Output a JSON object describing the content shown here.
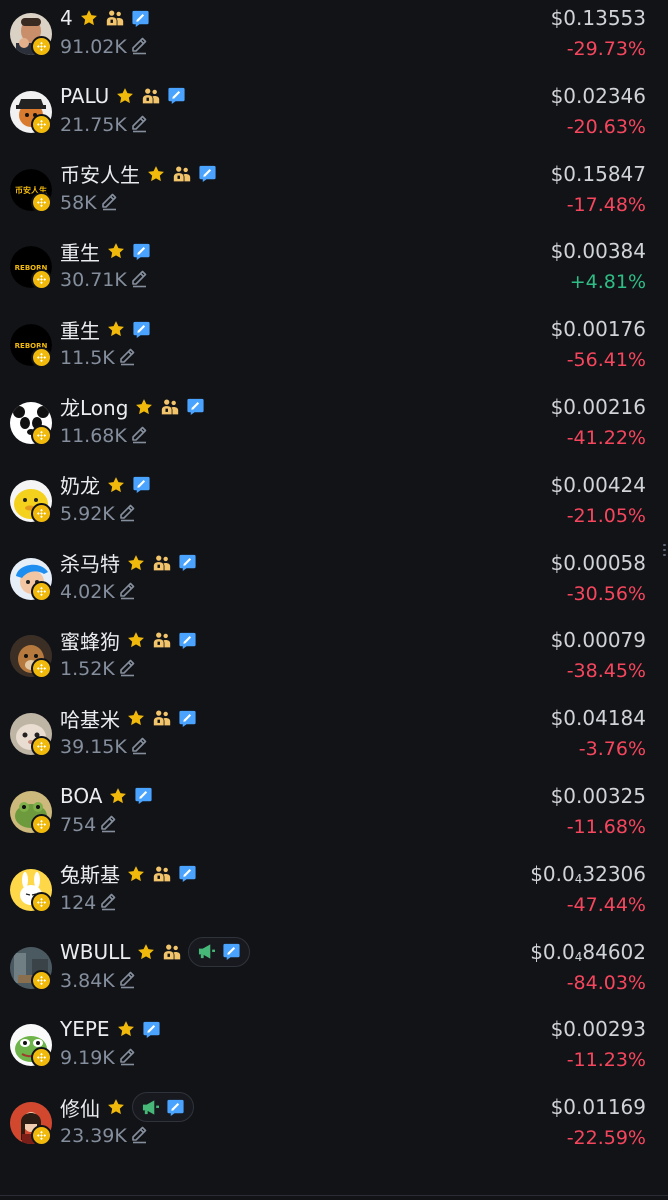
{
  "colors": {
    "background": "#121317",
    "negative": "#f6465d",
    "positive": "#2ebd85",
    "muted": "#848e9c",
    "star": "#f0b90b",
    "verified": "#4aa3ff",
    "cto_green": "#46b978"
  },
  "tokens": [
    {
      "name": "4",
      "mcap": "91.02K",
      "price": "$0.13553",
      "change": "-29.73%",
      "direction": "down",
      "community": true,
      "cto": false,
      "avatar": "man-portrait"
    },
    {
      "name": "PALU",
      "mcap": "21.75K",
      "price": "$0.02346",
      "change": "-20.63%",
      "direction": "down",
      "community": true,
      "cto": false,
      "avatar": "dog-cap"
    },
    {
      "name": "币安人生",
      "mcap": "58K",
      "price": "$0.15847",
      "change": "-17.48%",
      "direction": "down",
      "community": true,
      "cto": false,
      "avatar": "text-logo",
      "avatar_text": "币安人生"
    },
    {
      "name": "重生",
      "mcap": "30.71K",
      "price": "$0.00384",
      "change": "+4.81%",
      "direction": "up",
      "community": false,
      "cto": false,
      "avatar": "text-logo",
      "avatar_text": "REBORN"
    },
    {
      "name": "重生",
      "mcap": "11.5K",
      "price": "$0.00176",
      "change": "-56.41%",
      "direction": "down",
      "community": false,
      "cto": false,
      "avatar": "text-logo",
      "avatar_text": "REBORN"
    },
    {
      "name": "龙Long",
      "mcap": "11.68K",
      "price": "$0.00216",
      "change": "-41.22%",
      "direction": "down",
      "community": true,
      "cto": false,
      "avatar": "panda"
    },
    {
      "name": "奶龙",
      "mcap": "5.92K",
      "price": "$0.00424",
      "change": "-21.05%",
      "direction": "down",
      "community": false,
      "cto": false,
      "avatar": "yellow-blob"
    },
    {
      "name": "杀马特",
      "mcap": "4.02K",
      "price": "$0.00058",
      "change": "-30.56%",
      "direction": "down",
      "community": true,
      "cto": false,
      "avatar": "blue-hair"
    },
    {
      "name": "蜜蜂狗",
      "mcap": "1.52K",
      "price": "$0.00079",
      "change": "-38.45%",
      "direction": "down",
      "community": true,
      "cto": false,
      "avatar": "dog"
    },
    {
      "name": "哈基米",
      "mcap": "39.15K",
      "price": "$0.04184",
      "change": "-3.76%",
      "direction": "down",
      "community": true,
      "cto": false,
      "avatar": "cat"
    },
    {
      "name": "BOA",
      "mcap": "754",
      "price": "$0.00325",
      "change": "-11.68%",
      "direction": "down",
      "community": false,
      "cto": false,
      "avatar": "frog"
    },
    {
      "name": "兔斯基",
      "mcap": "124",
      "price_prefix": "$0.0",
      "price_sub": "4",
      "price_rest": "32306",
      "change": "-47.44%",
      "direction": "down",
      "community": true,
      "cto": false,
      "avatar": "bunny"
    },
    {
      "name": "WBULL",
      "mcap": "3.84K",
      "price_prefix": "$0.0",
      "price_sub": "4",
      "price_rest": "84602",
      "change": "-84.03%",
      "direction": "down",
      "community": true,
      "cto": true,
      "avatar": "street"
    },
    {
      "name": "YEPE",
      "mcap": "9.19K",
      "price": "$0.00293",
      "change": "-11.23%",
      "direction": "down",
      "community": false,
      "cto": false,
      "avatar": "pepe"
    },
    {
      "name": "修仙",
      "mcap": "23.39K",
      "price": "$0.01169",
      "change": "-22.59%",
      "direction": "down",
      "community": false,
      "cto": true,
      "avatar": "woman"
    }
  ]
}
